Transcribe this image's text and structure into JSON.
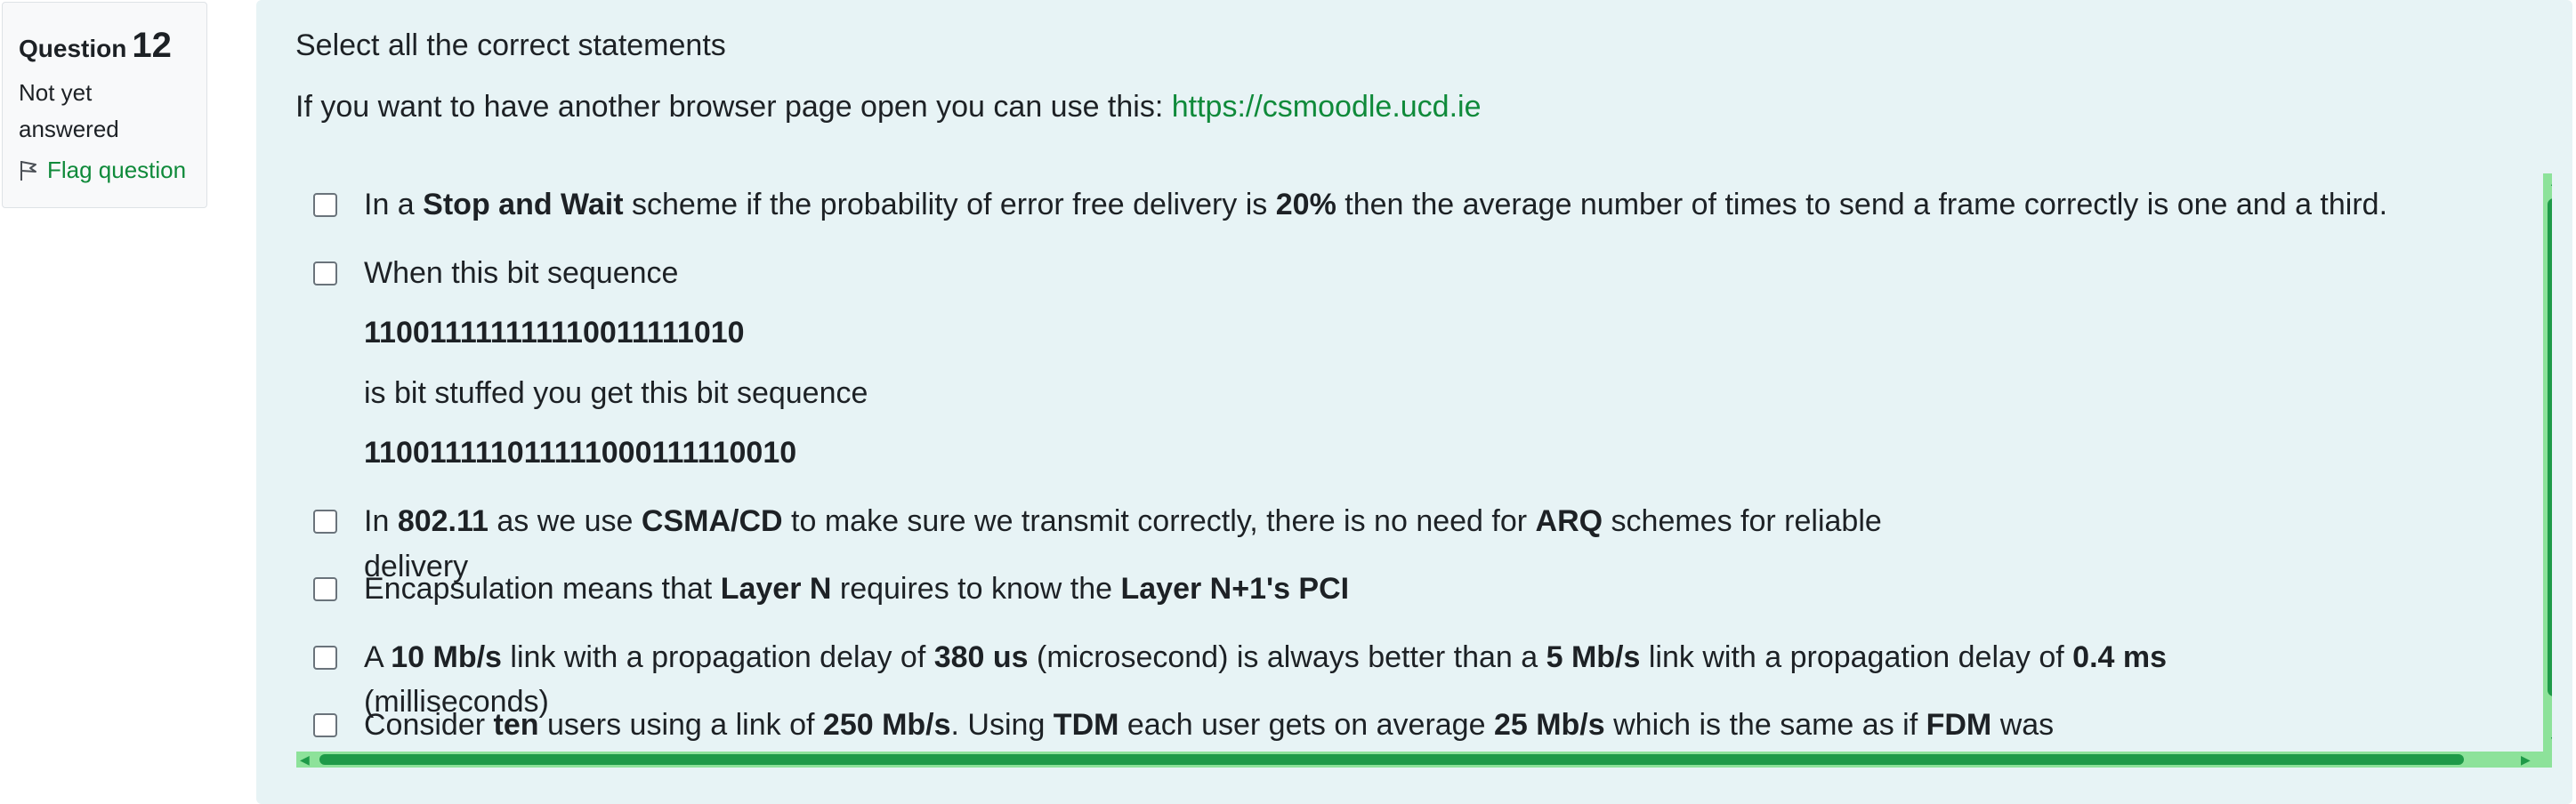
{
  "info": {
    "question_label": "Question",
    "question_number": "12",
    "state_line1": "Not yet",
    "state_line2": "answered",
    "flag_label": "Flag question"
  },
  "question": {
    "text": "Select all the correct statements",
    "browser_hint": "If you want to have another browser page open you can use this: ",
    "link": "https://csmoodle.ucd.ie"
  },
  "options": [
    {
      "t1": "In a ",
      "b1": "Stop and Wait",
      "t2": " scheme if the probability of error free delivery is ",
      "b2": "20%",
      "t3": " then the average number of times to send a frame correctly is one and a third."
    },
    {
      "t1": "When this bit sequence",
      "bits1": "110011111111110011111010",
      "t2": "is bit stuffed you get this bit sequence",
      "bits2": "11001111101111100011111 0010"
    },
    {
      "t1": "In ",
      "b1": "802.11",
      "t2": " as we use ",
      "b2": "CSMA/CD",
      "t3": " to make sure we transmit correctly, there is no need for ",
      "b3": "ARQ",
      "t4": " schemes for reliable",
      "wrap": "delivery"
    },
    {
      "t1": "Encapsulation means that ",
      "b1": "Layer N",
      "t2": " requires to know the ",
      "b2": "Layer N+1's PCI"
    },
    {
      "t1": "A ",
      "b1": "10 Mb/s",
      "t2": " link with a propagation delay of ",
      "b2": "380 us",
      "t3": " (microsecond) is always better than a ",
      "b3": "5 Mb/s",
      "t4": " link with a propagation delay of ",
      "b4": "0.4 ms",
      "wrap": "(milliseconds)"
    },
    {
      "t1": "Consider ",
      "b1": "ten",
      "t2": " users using a link of ",
      "b2": "250 Mb/s",
      "t3": ". Using ",
      "b3": "TDM",
      "t4": " each user gets on average ",
      "b4": "25 Mb/s",
      "t5": " which is the same as if ",
      "b5": "FDM",
      "t6": " was"
    }
  ],
  "icons": {
    "flag": "flag-icon",
    "checkbox": "checkbox"
  },
  "colors": {
    "link": "#0f8a3a",
    "panel": "#e7f3f5",
    "scrollbar": "#8de29a",
    "scroll_thumb": "#1e9a48"
  }
}
